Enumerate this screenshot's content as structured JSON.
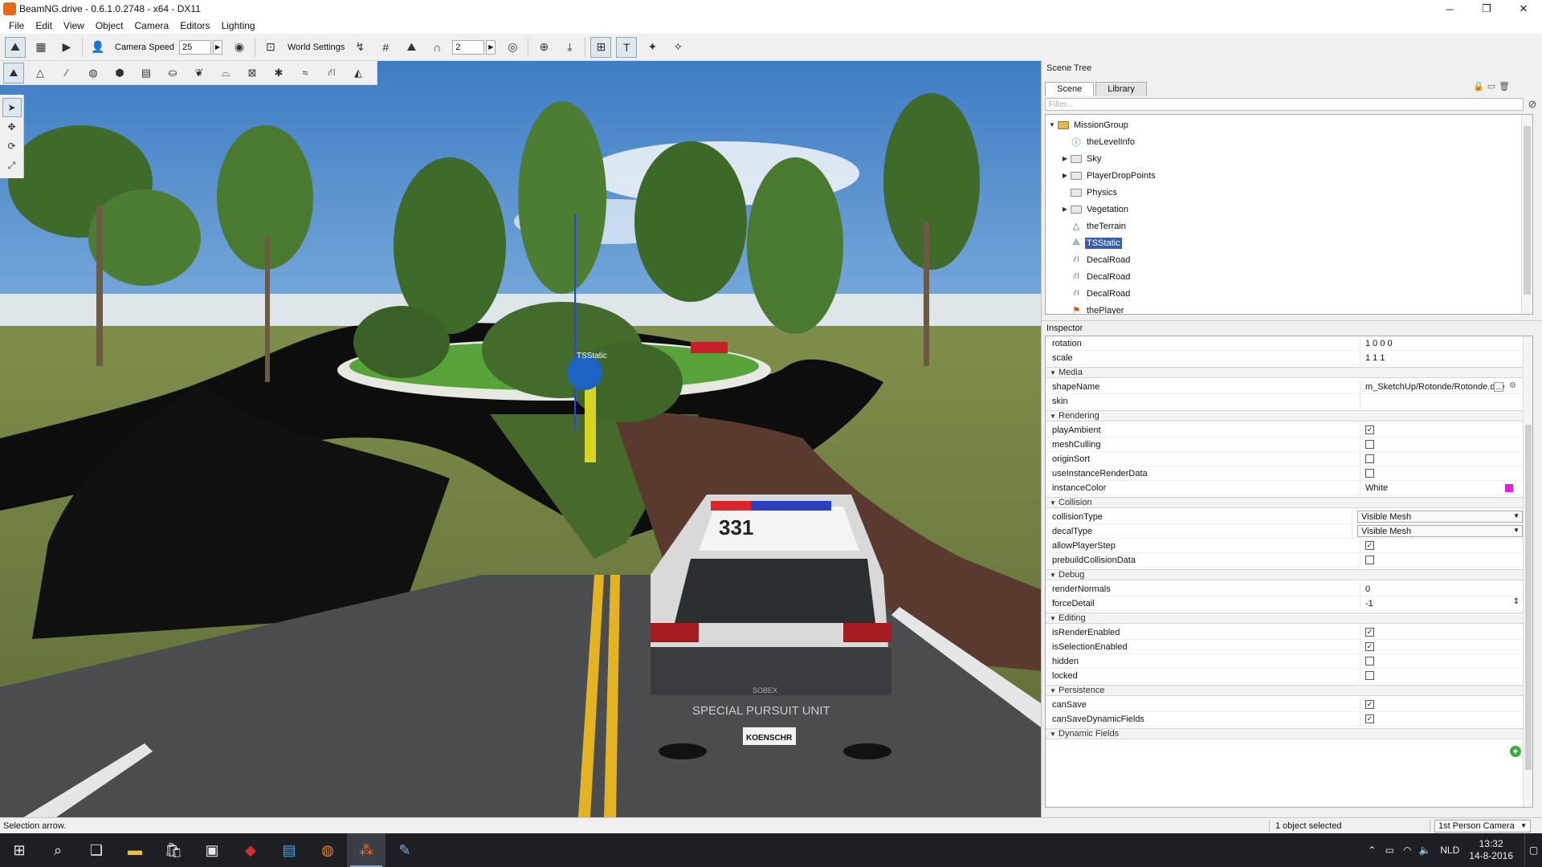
{
  "window": {
    "title": "BeamNG.drive - 0.6.1.0.2748 - x64 - DX11",
    "controls": {
      "minimize": "─",
      "maximize": "❐",
      "close": "✕"
    }
  },
  "menu": {
    "items": [
      "File",
      "Edit",
      "View",
      "Object",
      "Camera",
      "Editors",
      "Lighting"
    ]
  },
  "toolbar": {
    "camera_speed_label": "Camera Speed",
    "camera_speed_value": "25",
    "world_settings_label": "World Settings",
    "grid_value": "2"
  },
  "viewport": {
    "object_label": "TSStatic",
    "car_number": "331",
    "car_text": "SPECIAL PURSUIT UNIT",
    "plate": "KOENSCHR",
    "car_brand": "SOBEX"
  },
  "scene_tree": {
    "title": "Scene Tree",
    "tabs": [
      "Scene",
      "Library"
    ],
    "active_tab": "Scene",
    "filter_placeholder": "Filter...",
    "items": [
      {
        "label": "MissionGroup",
        "icon": "folder-open-icon",
        "expander": "▼"
      },
      {
        "label": "theLevelInfo",
        "icon": "info-icon",
        "expander": ""
      },
      {
        "label": "Sky",
        "icon": "folder-icon",
        "expander": "▶"
      },
      {
        "label": "PlayerDropPoints",
        "icon": "folder-icon",
        "expander": "▶"
      },
      {
        "label": "Physics",
        "icon": "folder-icon",
        "expander": ""
      },
      {
        "label": "Vegetation",
        "icon": "folder-icon",
        "expander": "▶"
      },
      {
        "label": "theTerrain",
        "icon": "terrain-icon",
        "expander": ""
      },
      {
        "label": "TSStatic",
        "icon": "tsstatic-icon",
        "expander": "",
        "selected": true
      },
      {
        "label": "DecalRoad",
        "icon": "road-icon",
        "expander": ""
      },
      {
        "label": "DecalRoad",
        "icon": "road-icon",
        "expander": ""
      },
      {
        "label": "DecalRoad",
        "icon": "road-icon",
        "expander": ""
      },
      {
        "label": "thePlayer",
        "icon": "player-icon",
        "expander": ""
      }
    ]
  },
  "inspector": {
    "title": "Inspector",
    "top_rows": [
      {
        "key": "rotation",
        "value": "1 0 0 0"
      },
      {
        "key": "scale",
        "value": "1 1 1"
      }
    ],
    "groups": {
      "media": {
        "label": "Media",
        "rows": [
          {
            "key": "shapeName",
            "value": "m_SketchUp/Rotonde/Rotonde.dae",
            "browse": "..."
          },
          {
            "key": "skin",
            "value": ""
          }
        ]
      },
      "rendering": {
        "label": "Rendering",
        "rows": [
          {
            "key": "playAmbient",
            "checked": true
          },
          {
            "key": "meshCulling",
            "checked": false
          },
          {
            "key": "originSort",
            "checked": false
          },
          {
            "key": "useInstanceRenderData",
            "checked": false
          },
          {
            "key": "instanceColor",
            "value": "White",
            "swatch": "#e020e0"
          }
        ]
      },
      "collision": {
        "label": "Collision",
        "rows": [
          {
            "key": "collisionType",
            "dropdown": "Visible Mesh"
          },
          {
            "key": "decalType",
            "dropdown": "Visible Mesh"
          },
          {
            "key": "allowPlayerStep",
            "checked": true
          },
          {
            "key": "prebuildCollisionData",
            "checked": false
          }
        ]
      },
      "debug": {
        "label": "Debug",
        "rows": [
          {
            "key": "renderNormals",
            "value": "0"
          },
          {
            "key": "forceDetail",
            "value": "-1"
          }
        ]
      },
      "editing": {
        "label": "Editing",
        "rows": [
          {
            "key": "isRenderEnabled",
            "checked": true
          },
          {
            "key": "isSelectionEnabled",
            "checked": true
          },
          {
            "key": "hidden",
            "checked": false
          },
          {
            "key": "locked",
            "checked": false
          }
        ]
      },
      "persistence": {
        "label": "Persistence",
        "rows": [
          {
            "key": "canSave",
            "checked": true
          },
          {
            "key": "canSaveDynamicFields",
            "checked": true
          }
        ]
      },
      "dynamic": {
        "label": "Dynamic Fields",
        "rows": []
      }
    },
    "add_field": "+"
  },
  "status": {
    "hint": "Selection arrow.",
    "selection_count": "1 object selected",
    "camera_mode": "1st Person Camera"
  },
  "taskbar": {
    "language": "NLD",
    "time": "13:32",
    "date": "14-8-2016"
  },
  "colors": {
    "accent_selection": "#3a5ea8",
    "instance_color_swatch": "#e020e0",
    "taskbar_bg": "#1d1f24"
  }
}
